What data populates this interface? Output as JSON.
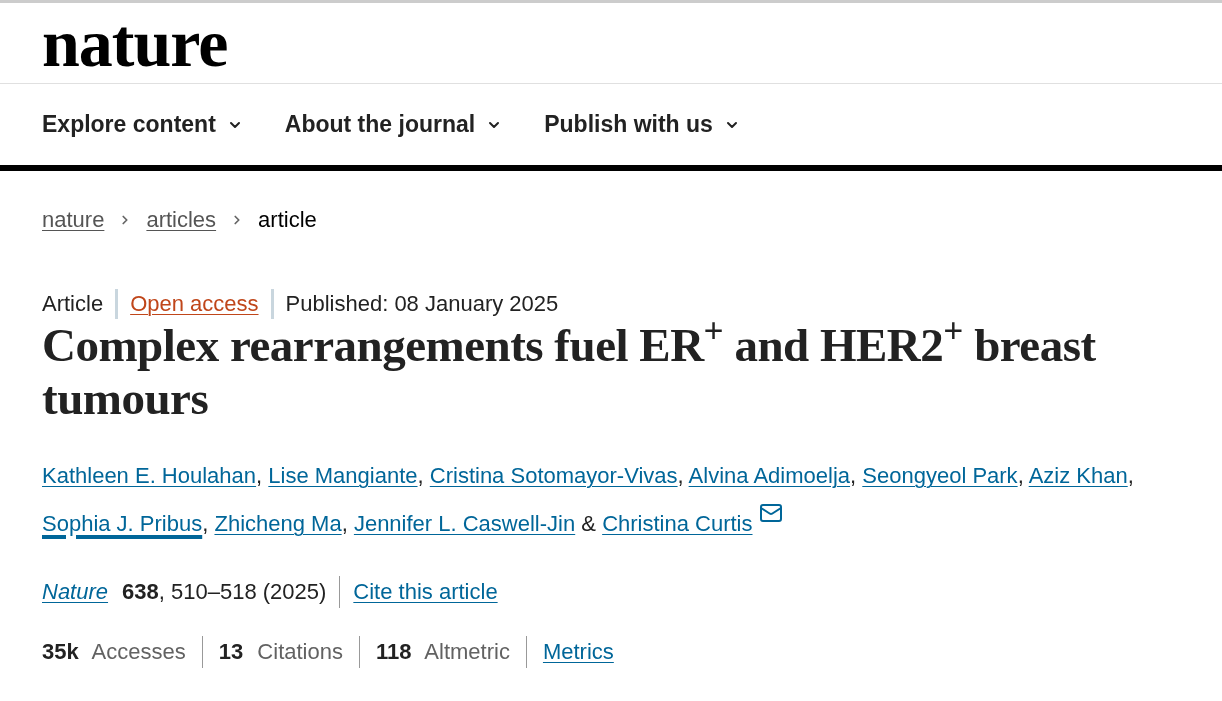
{
  "logo": "nature",
  "nav": [
    {
      "label": "Explore content"
    },
    {
      "label": "About the journal"
    },
    {
      "label": "Publish with us"
    }
  ],
  "breadcrumb": [
    {
      "label": "nature",
      "kind": "link"
    },
    {
      "label": "articles",
      "kind": "link"
    },
    {
      "label": "article",
      "kind": "current"
    }
  ],
  "article": {
    "type": "Article",
    "access": "Open access",
    "published": "Published: 08 January 2025",
    "title": "Complex rearrangements fuel ER$^{+}$ and HER2$^{+}$ breast tumours",
    "authors": [
      {
        "name": "Kathleen E. Houlahan",
        "hovered": false,
        "corresponding": false,
        "after": {
          "kind": "comma",
          "text": ","
        }
      },
      {
        "name": "Lise Mangiante",
        "hovered": false,
        "corresponding": false,
        "after": {
          "kind": "comma",
          "text": ","
        }
      },
      {
        "name": "Cristina Sotomayor-Vivas",
        "hovered": false,
        "corresponding": false,
        "after": {
          "kind": "comma",
          "text": ","
        }
      },
      {
        "name": "Alvina Adimoelja",
        "hovered": false,
        "corresponding": false,
        "after": {
          "kind": "comma",
          "text": ","
        }
      },
      {
        "name": "Seongyeol Park",
        "hovered": false,
        "corresponding": false,
        "after": {
          "kind": "comma",
          "text": ","
        }
      },
      {
        "name": "Aziz Khan",
        "hovered": false,
        "corresponding": false,
        "after": {
          "kind": "comma",
          "text": ","
        }
      },
      {
        "name": "Sophia J. Pribus",
        "hovered": true,
        "corresponding": false,
        "after": {
          "kind": "comma",
          "text": ","
        }
      },
      {
        "name": "Zhicheng Ma",
        "hovered": false,
        "corresponding": false,
        "after": {
          "kind": "comma",
          "text": ","
        }
      },
      {
        "name": "Jennifer L. Caswell-Jin",
        "hovered": false,
        "corresponding": false,
        "after": {
          "kind": "conjunction",
          "text": "&"
        }
      },
      {
        "name": "Christina Curtis",
        "hovered": false,
        "corresponding": true
      }
    ],
    "citation": {
      "journal": "Nature",
      "reference": "**638**, 510–518 (2025)",
      "cite_link": "Cite this article"
    },
    "metrics": [
      "**35k** Accesses",
      "**13** Citations",
      "**118** Altmetric"
    ],
    "metrics_link": "Metrics"
  }
}
